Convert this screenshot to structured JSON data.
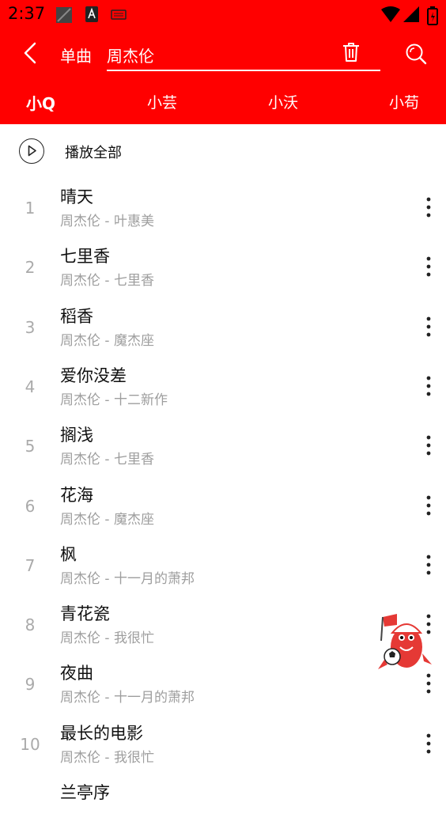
{
  "status": {
    "time": "2:37"
  },
  "header": {
    "type_label": "单曲",
    "query": "周杰伦"
  },
  "tabs": [
    {
      "label": "小Q"
    },
    {
      "label": "小芸"
    },
    {
      "label": "小沃"
    },
    {
      "label": "小苟"
    }
  ],
  "play_all": {
    "label": "播放全部"
  },
  "songs": [
    {
      "num": "1",
      "title": "晴天",
      "sub": "周杰伦 - 叶惠美"
    },
    {
      "num": "2",
      "title": "七里香",
      "sub": "周杰伦 - 七里香"
    },
    {
      "num": "3",
      "title": "稻香",
      "sub": "周杰伦 - 魔杰座"
    },
    {
      "num": "4",
      "title": "爱你没差",
      "sub": "周杰伦 - 十二新作"
    },
    {
      "num": "5",
      "title": "搁浅",
      "sub": "周杰伦 - 七里香"
    },
    {
      "num": "6",
      "title": "花海",
      "sub": "周杰伦 - 魔杰座"
    },
    {
      "num": "7",
      "title": "枫",
      "sub": "周杰伦 - 十一月的萧邦"
    },
    {
      "num": "8",
      "title": "青花瓷",
      "sub": "周杰伦 - 我很忙"
    },
    {
      "num": "9",
      "title": "夜曲",
      "sub": "周杰伦 - 十一月的萧邦"
    },
    {
      "num": "10",
      "title": "最长的电影",
      "sub": "周杰伦 - 我很忙"
    },
    {
      "num": "",
      "title": "兰亭序",
      "sub": ""
    }
  ],
  "colors": {
    "brand": "#ff0000",
    "muted": "#9e9e9e"
  }
}
